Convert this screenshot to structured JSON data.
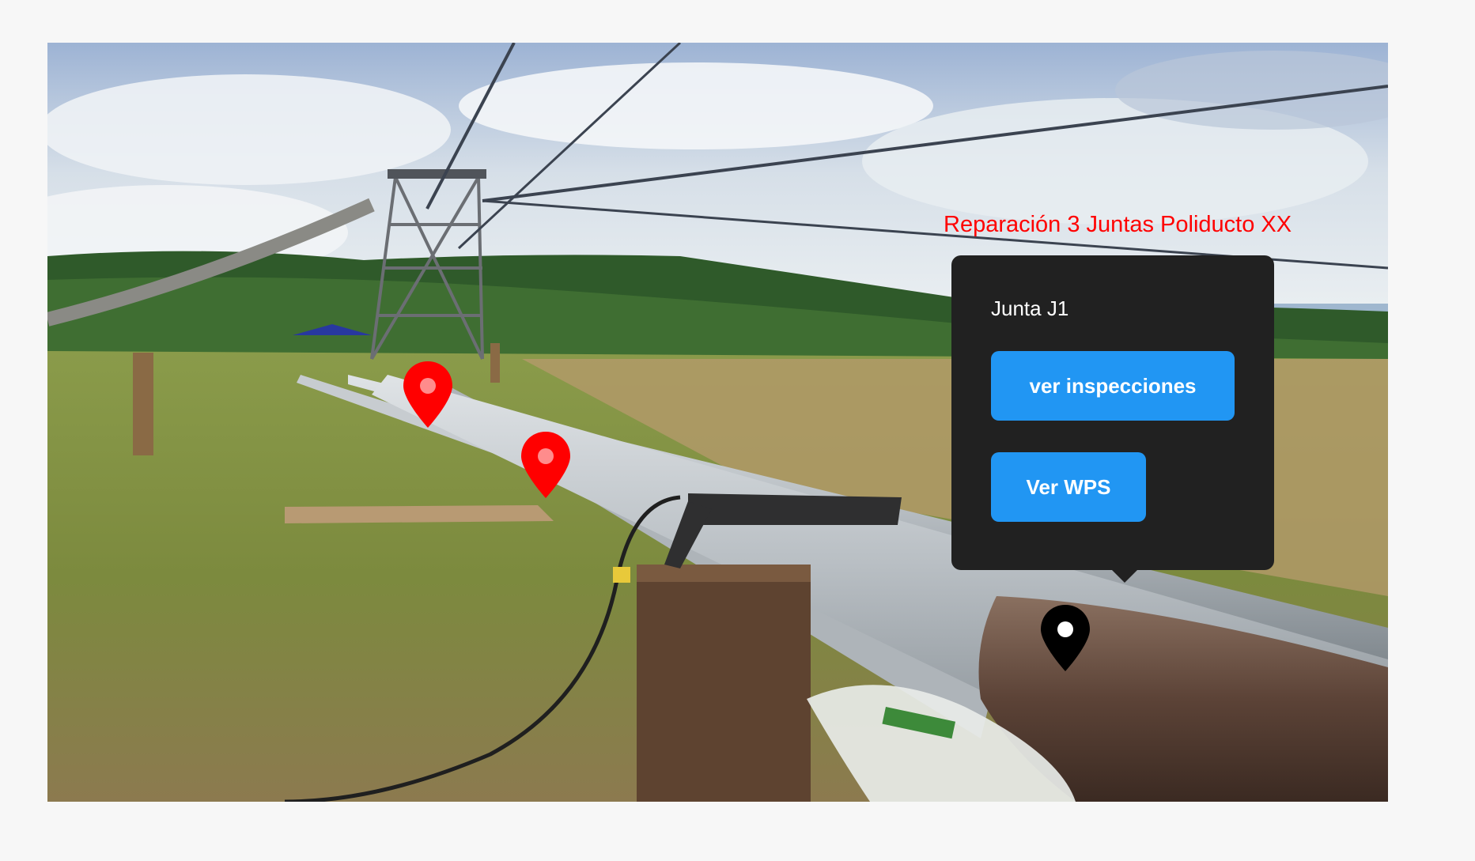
{
  "title": "Reparación 3 Juntas Poliducto XX",
  "popup": {
    "heading": "Junta J1",
    "inspections_button": "ver inspecciones",
    "wps_button": "Ver WPS"
  },
  "markers": [
    {
      "label": "map-pin-icon",
      "color": "#ff0000",
      "state": "inactive"
    },
    {
      "label": "map-pin-icon",
      "color": "#ff0000",
      "state": "inactive"
    },
    {
      "label": "map-pin-icon",
      "color": "#000000",
      "state": "selected"
    }
  ],
  "colors": {
    "title": "#ff0000",
    "popup_bg": "#212121",
    "button": "#2196f3"
  }
}
